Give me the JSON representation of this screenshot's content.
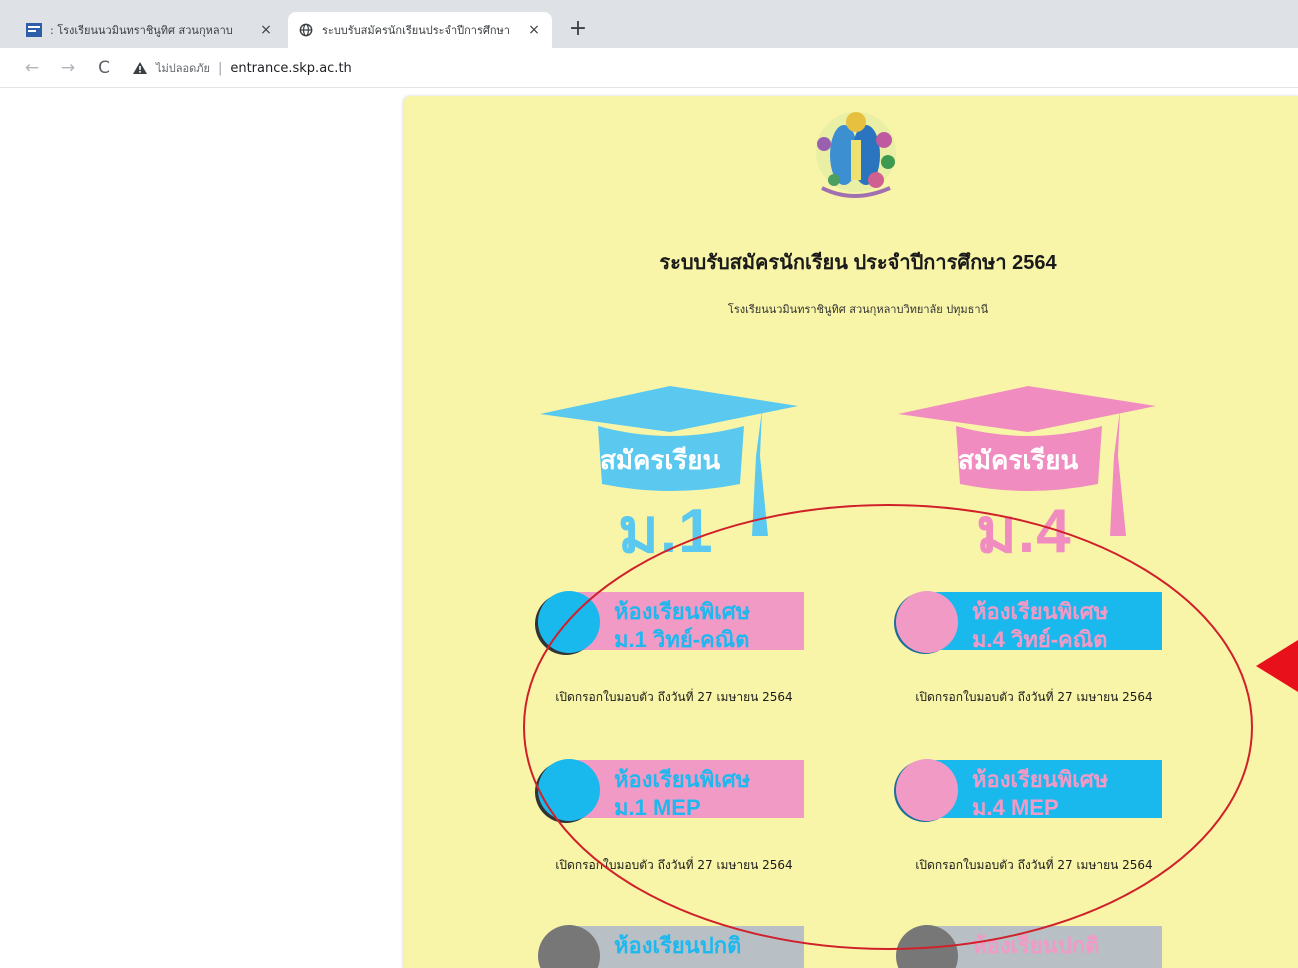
{
  "browser": {
    "tabs": [
      {
        "title": ": โรงเรียนนวมินทราชินูทิศ สวนกุหลาบ",
        "active": false
      },
      {
        "title": "ระบบรับสมัครนักเรียนประจำปีการศึกษา",
        "active": true
      }
    ],
    "close_glyph": "×",
    "newtab_glyph": "+",
    "nav": {
      "back": "←",
      "forward": "→",
      "reload": "C"
    },
    "security_label": "ไม่ปลอดภัย",
    "separator": "|",
    "url": "entrance.skp.ac.th"
  },
  "page": {
    "background": "#f8f5a8",
    "title": "ระบบรับสมัครนักเรียน ประจำปีการศึกษา 2564",
    "subtitle": "โรงเรียนนวมินทราชินูทิศ สวนกุหลาบวิทยาลัย ปทุมธานี",
    "caps": [
      {
        "label": "สมัครเรียน",
        "grade": "ม.1",
        "color": "#5bc8f0"
      },
      {
        "label": "สมัครเรียน",
        "grade": "ม.4",
        "color": "#f08cc0"
      }
    ],
    "rooms": [
      {
        "line1": "ห้องเรียนพิเศษ",
        "line2": "ม.1 วิทย์-คณิต",
        "note": "เปิดกรอกใบมอบตัว ถึงวันที่ 27 เมษายน 2564"
      },
      {
        "line1": "ห้องเรียนพิเศษ",
        "line2": "ม.4 วิทย์-คณิต",
        "note": "เปิดกรอกใบมอบตัว ถึงวันที่ 27 เมษายน 2564"
      },
      {
        "line1": "ห้องเรียนพิเศษ",
        "line2": "ม.1 MEP",
        "note": "เปิดกรอกใบมอบตัว ถึงวันที่ 27 เมษายน 2564"
      },
      {
        "line1": "ห้องเรียนพิเศษ",
        "line2": "ม.4 MEP",
        "note": "เปิดกรอกใบมอบตัว ถึงวันที่ 27 เมษายน 2564"
      },
      {
        "line1": "ห้องเรียนปกติ",
        "line2": ""
      },
      {
        "line1": "ห้องเรียนปกติ",
        "line2": ""
      }
    ]
  },
  "annotation": {
    "stroke": "#d0202a",
    "arrow": "#e8101a"
  }
}
